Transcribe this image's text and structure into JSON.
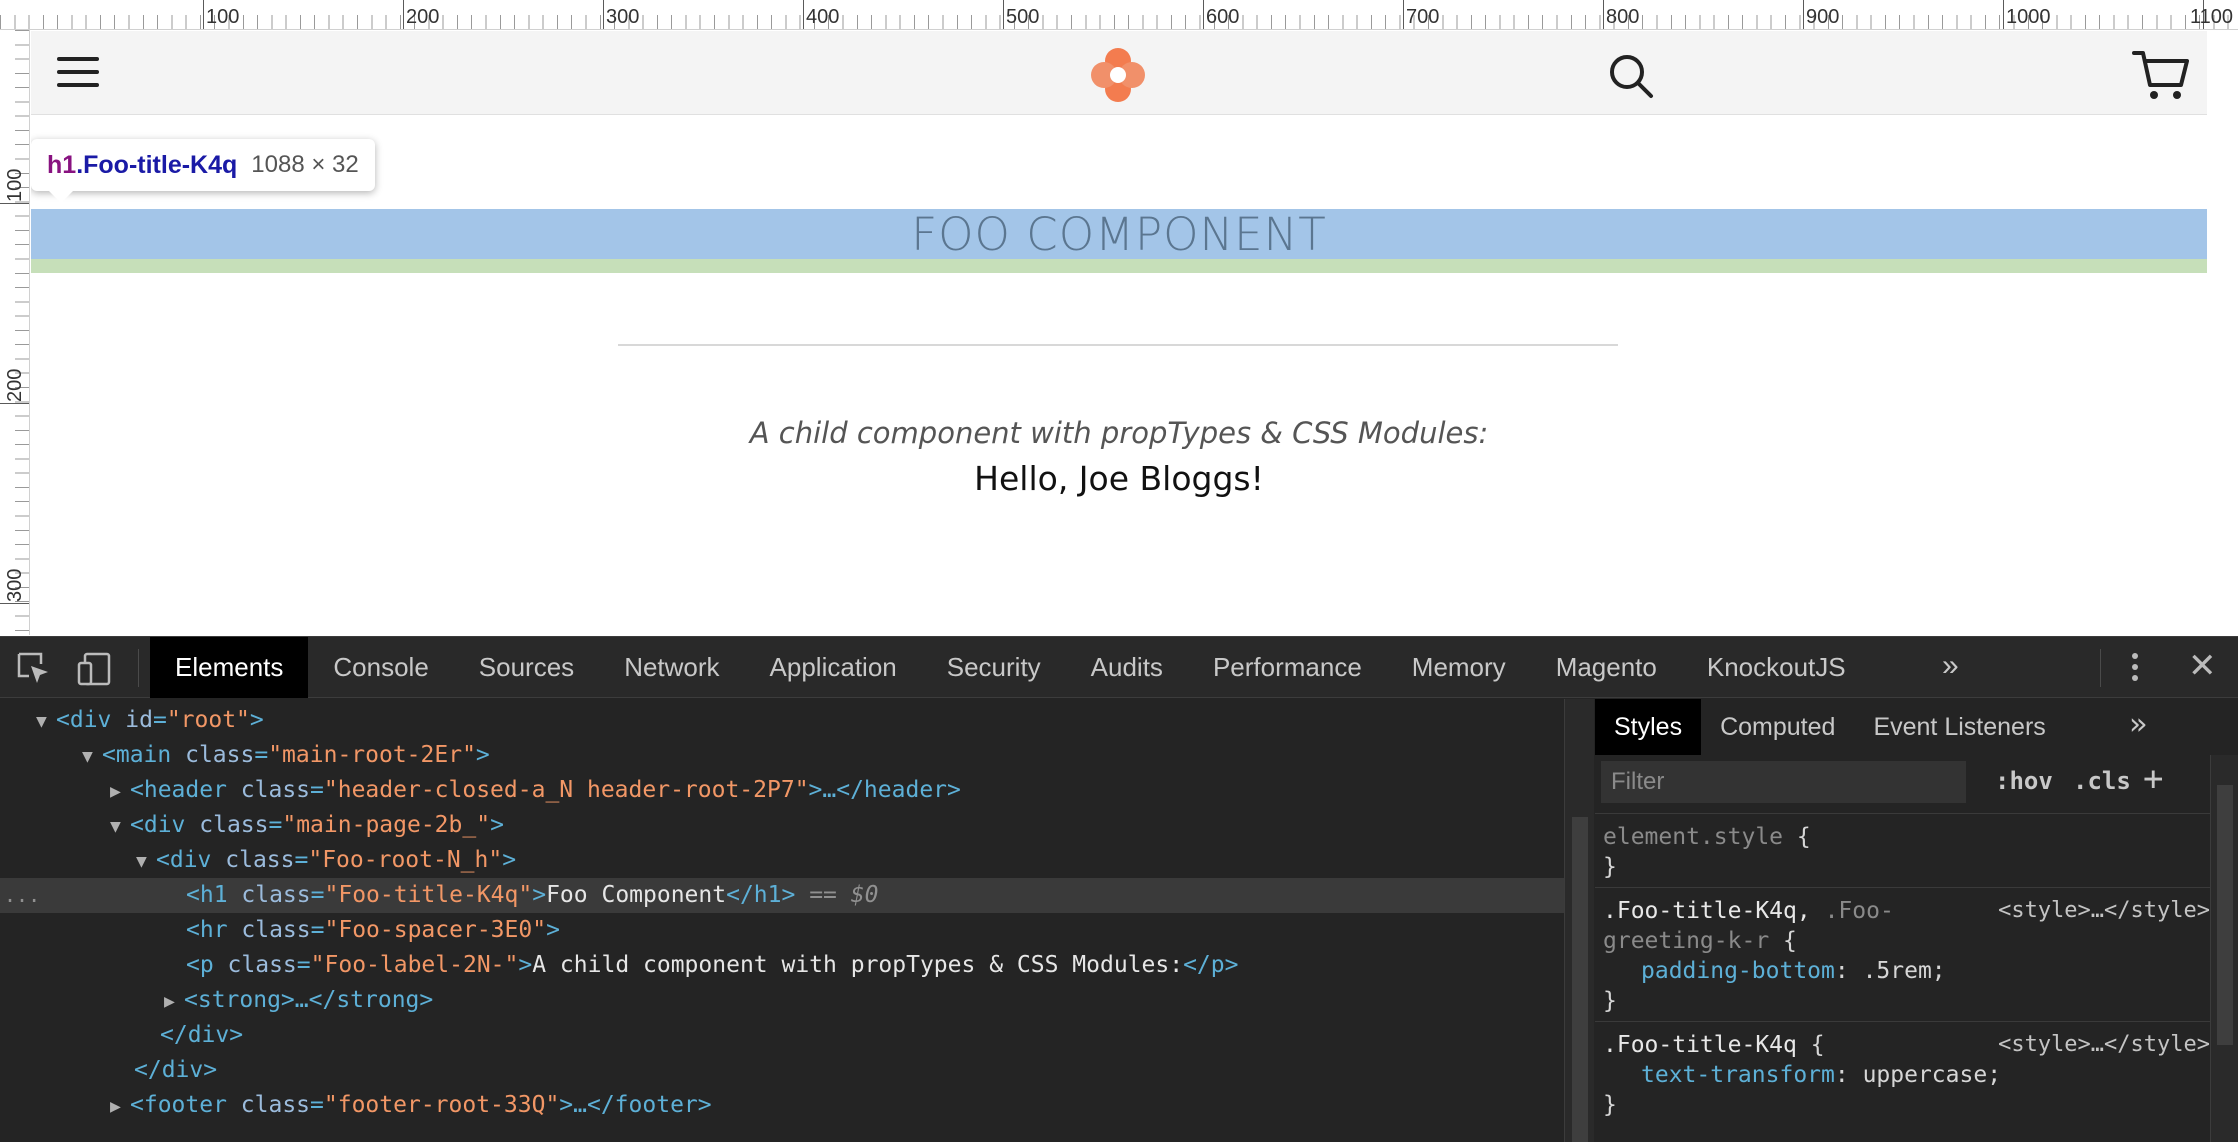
{
  "ruler": {
    "top_labels": [
      "100",
      "200",
      "300",
      "400",
      "500",
      "600",
      "700",
      "800",
      "900",
      "1000",
      "1100"
    ],
    "left_labels": [
      "100",
      "200",
      "300"
    ]
  },
  "page": {
    "title": "FOO COMPONENT",
    "label": "A child component with propTypes & CSS Modules:",
    "greeting": "Hello, Joe Bloggs!",
    "tooltip": {
      "tag": "h1",
      "class": ".Foo-title-K4q",
      "size": "1088 × 32"
    }
  },
  "icons": {
    "menu": "hamburger-icon",
    "logo": "logo-icon",
    "search": "search-icon",
    "cart": "cart-icon"
  },
  "colors": {
    "highlight_content": "#a3c5e8",
    "highlight_padding": "#c6dfb9",
    "logo": "#f37c4f"
  },
  "devtools": {
    "tabs": [
      "Elements",
      "Console",
      "Sources",
      "Network",
      "Application",
      "Security",
      "Audits",
      "Performance",
      "Memory",
      "Magento",
      "KnockoutJS"
    ],
    "active_tab": "Elements",
    "more": "»",
    "close": "✕",
    "elements": {
      "line0": {
        "open": "<div ",
        "attr": "id",
        "val": "\"root\"",
        "close": ">"
      },
      "line1": {
        "open": "<main ",
        "attr": "class",
        "val": "\"main-root-2Er\"",
        "close": ">"
      },
      "line2": {
        "open": "<header ",
        "attr": "class",
        "val": "\"header-closed-a_N header-root-2P7\"",
        "close": ">…</header>"
      },
      "line3": {
        "open": "<div ",
        "attr": "class",
        "val": "\"main-page-2b_\"",
        "close": ">"
      },
      "line4": {
        "open": "<div ",
        "attr": "class",
        "val": "\"Foo-root-N_h\"",
        "close": ">"
      },
      "line5": {
        "open": "<h1 ",
        "attr": "class",
        "val": "\"Foo-title-K4q\"",
        "close": ">",
        "text": "Foo Component",
        "end": "</h1>",
        "marker": "== $0",
        "dots": "..."
      },
      "line6": {
        "open": "<hr ",
        "attr": "class",
        "val": "\"Foo-spacer-3E0\"",
        "close": ">"
      },
      "line7": {
        "open": "<p ",
        "attr": "class",
        "val": "\"Foo-label-2N-\"",
        "close": ">",
        "text": "A child component with propTypes & CSS Modules:",
        "end": "</p>"
      },
      "line8": {
        "open": "<strong>",
        "close": "…</strong>"
      },
      "line9": {
        "open": "</div>"
      },
      "line10": {
        "open": "</div>"
      },
      "line11": {
        "open": "<footer ",
        "attr": "class",
        "val": "\"footer-root-33Q\"",
        "close": ">…</footer>"
      }
    },
    "styles": {
      "tabs": [
        "Styles",
        "Computed",
        "Event Listeners"
      ],
      "active_tab": "Styles",
      "more": "»",
      "filter_placeholder": "Filter",
      "hov": ":hov",
      "cls": ".cls",
      "plus": "+",
      "rule0": {
        "selector": "element.style",
        "open": " {",
        "close": "}"
      },
      "rule1": {
        "selector": ".Foo-title-K4q,",
        "selector_dim_a": " .Foo-",
        "selector_dim_b": "greeting-k-r",
        "open": " {",
        "source": "<style>…</style>",
        "prop": "padding-bottom",
        "value": ": .5rem;",
        "close": "}"
      },
      "rule2": {
        "selector": ".Foo-title-K4q",
        "open": " {",
        "source": "<style>…</style>",
        "prop": "text-transform",
        "value": ": uppercase;",
        "close": "}"
      }
    }
  }
}
